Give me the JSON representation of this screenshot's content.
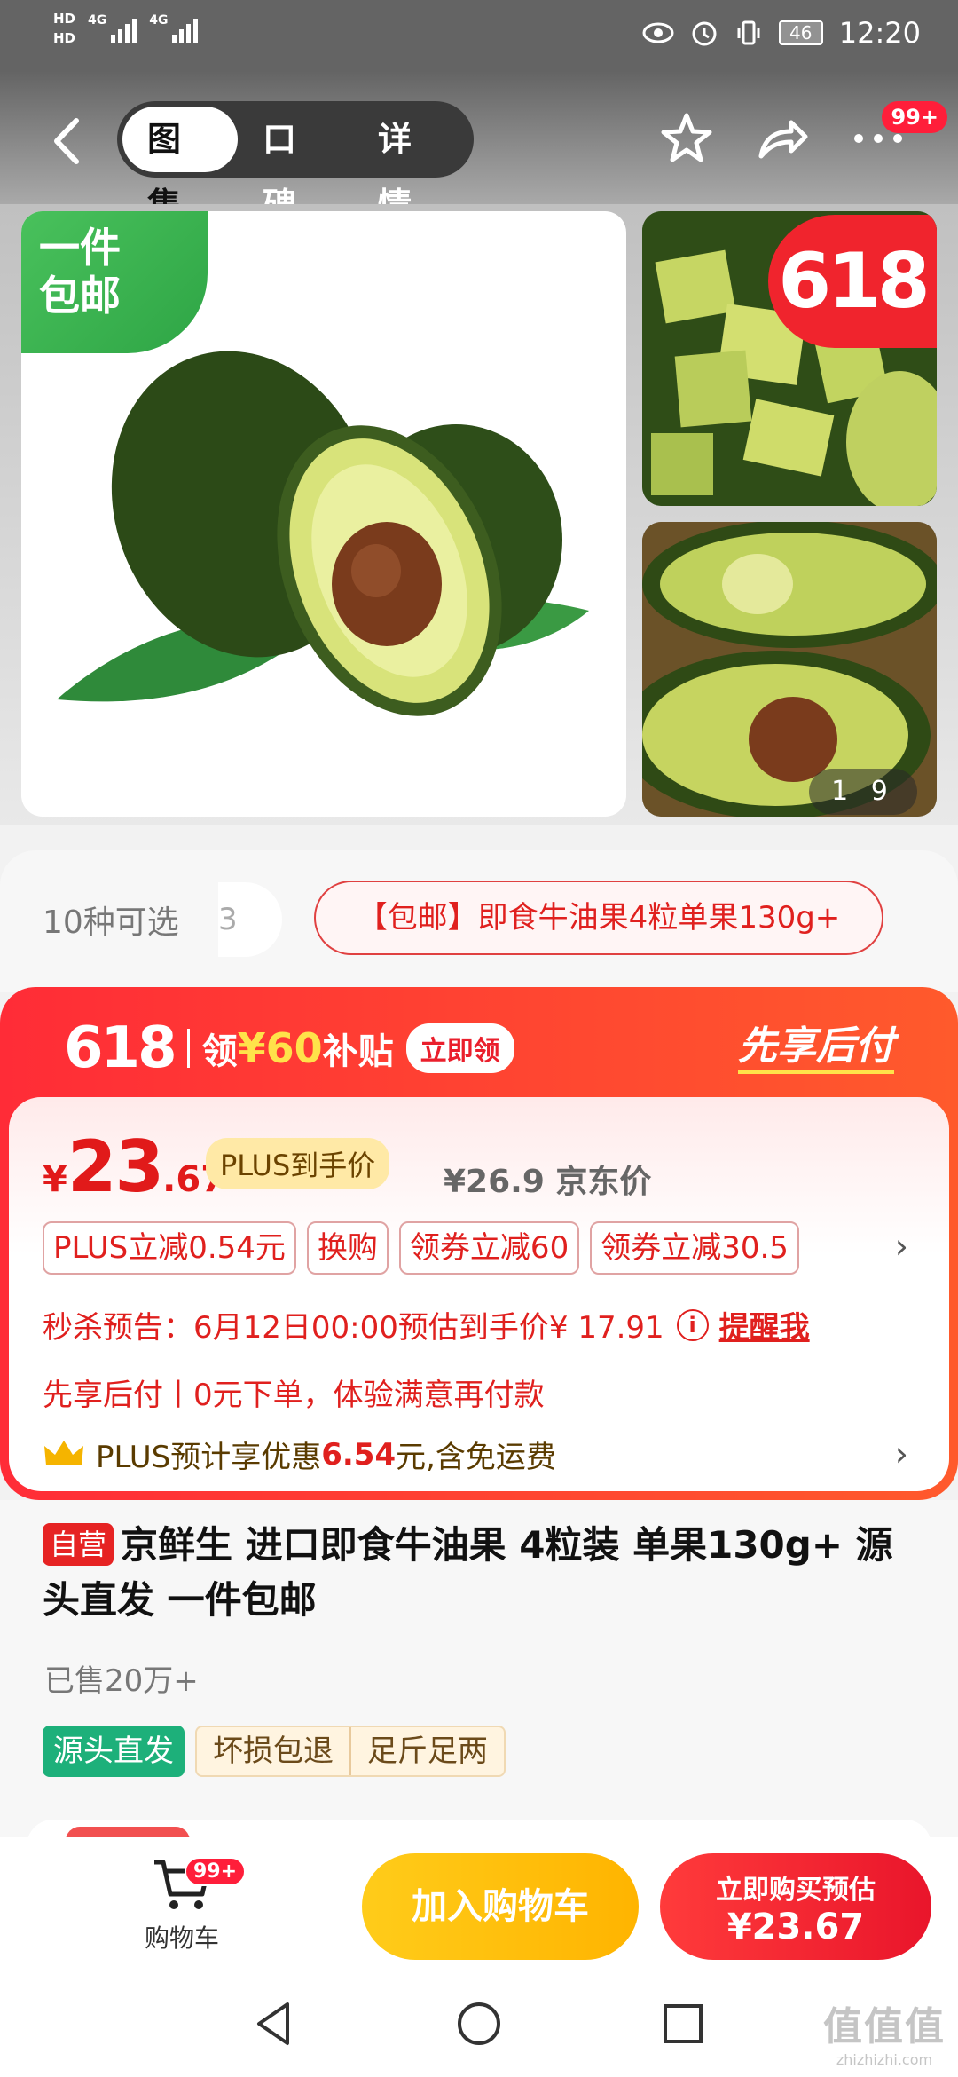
{
  "status_bar": {
    "hd1": "HD",
    "hd2": "HD",
    "net1": "4G",
    "net2": "4G",
    "battery": "46",
    "time": "12:20"
  },
  "header": {
    "tabs": [
      {
        "label": "图集",
        "active": true
      },
      {
        "label": "口碑",
        "active": false
      },
      {
        "label": "详情",
        "active": false
      }
    ],
    "more_badge": "99+"
  },
  "gallery": {
    "ribbon_line1": "一件",
    "ribbon_line2": "包邮",
    "badge_618": "618",
    "pager": "1 9"
  },
  "options": {
    "count_label": "10种可选",
    "ghost_chip": "3",
    "selected_chip": "【包邮】即食牛油果4粒单果130g+"
  },
  "promo": {
    "tag_618": "618",
    "claim_prefix": "领",
    "claim_amount": "¥60",
    "claim_suffix": "补贴",
    "claim_button": "立即领",
    "pay_later": "先享后付",
    "currency": "¥",
    "price_int": "23",
    "price_dec": ".67",
    "plus_tag": "PLUS到手价",
    "jd_price": "¥26.9 京东价",
    "coupons": [
      "PLUS立减0.54元",
      "换购",
      "领券立减60",
      "领券立减30.5"
    ],
    "seckill_text": "秒杀预告：6月12日00:00预估到手价¥ 17.91",
    "seckill_info": "i",
    "remind": "提醒我",
    "paylater_line": "先享后付丨0元下单，体验满意再付款",
    "plus_line_prefix": "PLUS预计享优惠",
    "plus_line_amount": "6.54",
    "plus_line_suffix": "元,含免运费",
    "chevron": "›"
  },
  "product": {
    "self_badge": "自营",
    "title": "京鲜生 进口即食牛油果 4粒装 单果130g+ 源头直发 一件包邮",
    "sold": "已售20万+",
    "tag_green": "源头直发",
    "tag_beige": [
      "坏损包退",
      "足斤足两"
    ]
  },
  "bottom": {
    "cart_badge": "99+",
    "cart_label": "购物车",
    "add_cart": "加入购物车",
    "buy_line1": "立即购买预估",
    "buy_line2": "¥23.67"
  },
  "watermark": {
    "line1": "值值值",
    "line2": "zhizhizhi.com"
  },
  "colors": {
    "jd_red": "#e11a1a",
    "promo_red": "#ff2c37",
    "gold": "#ffe24a",
    "add_cart_yellow": "#ffb400",
    "green_tag": "#1db07a"
  }
}
